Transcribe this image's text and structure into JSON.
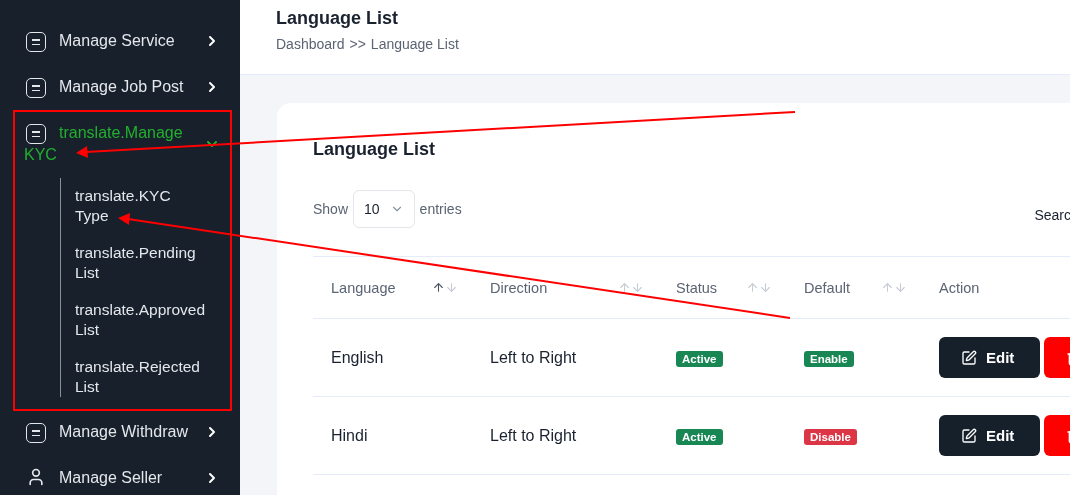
{
  "sidebar": {
    "items": [
      {
        "kind": "module",
        "label": "Manage Service",
        "expanded": false
      },
      {
        "kind": "module",
        "label": "Manage Job Post",
        "expanded": false
      },
      {
        "kind": "module",
        "label": "translate.Manage KYC",
        "expanded": true,
        "children": [
          {
            "label": "translate.KYC Type"
          },
          {
            "label": "translate.Pending List"
          },
          {
            "label": "translate.Approved List"
          },
          {
            "label": "translate.Rejected List"
          }
        ]
      },
      {
        "kind": "module",
        "label": "Manage Withdraw",
        "expanded": false
      },
      {
        "kind": "people",
        "label": "Manage Seller",
        "expanded": false
      }
    ]
  },
  "header": {
    "title": "Language List",
    "breadcrumb": [
      "Dashboard",
      "Language List"
    ],
    "separator": ">>"
  },
  "card": {
    "title": "Language List",
    "show_label": "Show",
    "entries_value": "10",
    "entries_label": "entries",
    "search_label": "Searc"
  },
  "table": {
    "columns": [
      {
        "label": "Language",
        "sorted": true
      },
      {
        "label": "Direction",
        "sorted": false
      },
      {
        "label": "Status",
        "sorted": false
      },
      {
        "label": "Default",
        "sorted": false
      },
      {
        "label": "Action"
      }
    ],
    "rows": [
      {
        "language": "English",
        "direction": "Left to Right",
        "status": {
          "label": "Active",
          "on": true
        },
        "default": {
          "label": "Enable",
          "on": true
        },
        "actions": [
          {
            "kind": "edit",
            "label": "Edit"
          },
          {
            "kind": "delete"
          }
        ]
      },
      {
        "language": "Hindi",
        "direction": "Left to Right",
        "status": {
          "label": "Active",
          "on": true
        },
        "default": {
          "label": "Disable",
          "on": false
        },
        "actions": [
          {
            "kind": "edit",
            "label": "Edit"
          },
          {
            "kind": "delete"
          }
        ]
      }
    ]
  }
}
